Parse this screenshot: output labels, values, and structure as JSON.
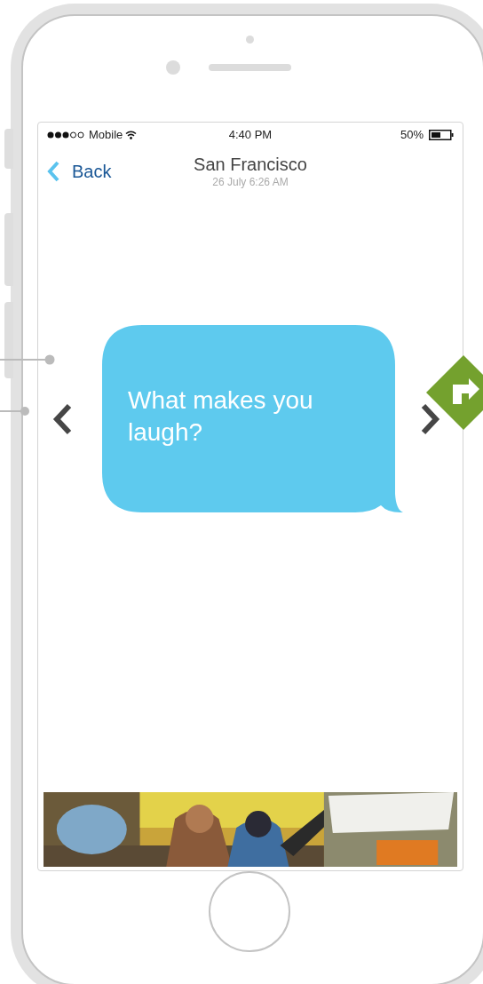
{
  "status_bar": {
    "carrier": "Mobile",
    "time": "4:40 PM",
    "battery": "50%"
  },
  "header": {
    "back": "Back",
    "title": "San Francisco",
    "subtitle": "26 July 6:26 AM"
  },
  "message": {
    "text": "What makes you laugh?"
  }
}
